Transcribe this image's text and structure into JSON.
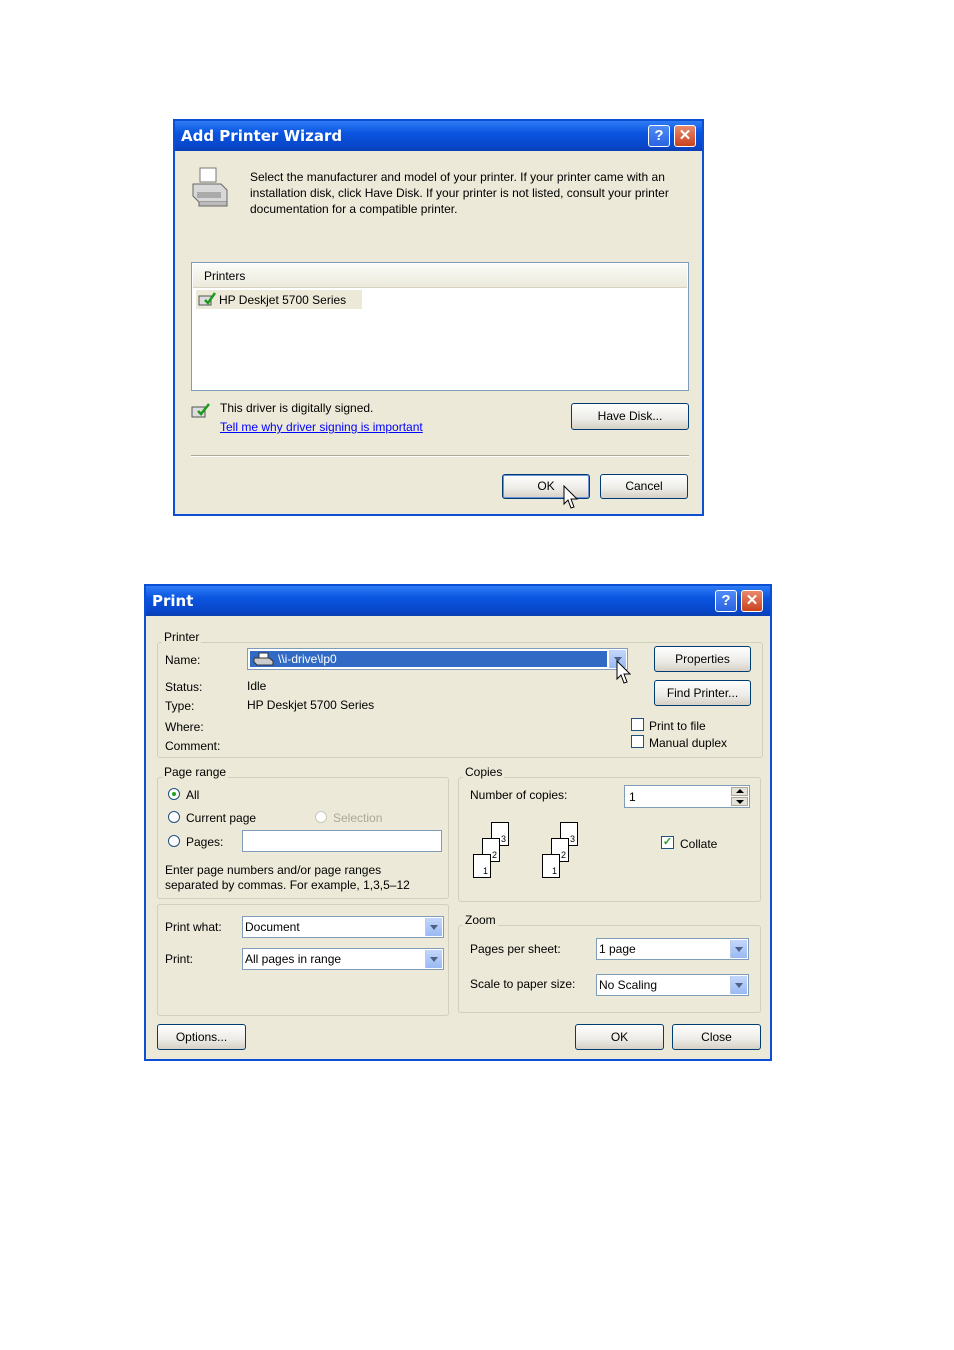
{
  "wizard": {
    "title": "Add Printer Wizard",
    "help_glyph": "?",
    "close_glyph": "✕",
    "instructions": "Select the manufacturer and model of your printer. If your printer came with an installation disk, click Have Disk. If your printer is not listed, consult your printer documentation for a compatible printer.",
    "printers_header": "Printers",
    "printers": [
      "HP Deskjet 5700 Series"
    ],
    "signed_text": "This driver is digitally signed.",
    "signing_link": "Tell me why driver signing is important",
    "have_disk_label": "Have Disk...",
    "ok_label": "OK",
    "cancel_label": "Cancel"
  },
  "print": {
    "title": "Print",
    "help_glyph": "?",
    "close_glyph": "✕",
    "printer_group": "Printer",
    "name_label": "Name:",
    "name_value": "\\\\i-drive\\lp0",
    "status_label": "Status:",
    "status_value": "Idle",
    "type_label": "Type:",
    "type_value": "HP Deskjet 5700 Series",
    "where_label": "Where:",
    "comment_label": "Comment:",
    "properties_label": "Properties",
    "find_printer_label": "Find Printer...",
    "print_to_file_label": "Print to file",
    "manual_duplex_label": "Manual duplex",
    "page_range_group": "Page range",
    "all_label": "All",
    "current_page_label": "Current page",
    "selection_label": "Selection",
    "pages_label": "Pages:",
    "pages_value": "",
    "range_hint_1": "Enter page numbers and/or page ranges",
    "range_hint_2": "separated by commas.  For example, 1,3,5–12",
    "copies_group": "Copies",
    "copies_label": "Number of copies:",
    "copies_value": "1",
    "collate_label": "Collate",
    "collate_checked": true,
    "stack_page_numbers": [
      "3",
      "2",
      "1"
    ],
    "print_what_label": "Print what:",
    "print_what_value": "Document",
    "print_label": "Print:",
    "print_value": "All pages in range",
    "zoom_group": "Zoom",
    "pages_per_sheet_label": "Pages per sheet:",
    "pages_per_sheet_value": "1 page",
    "scale_label": "Scale to paper size:",
    "scale_value": "No Scaling",
    "options_label": "Options...",
    "ok_label": "OK",
    "close_label": "Close"
  }
}
